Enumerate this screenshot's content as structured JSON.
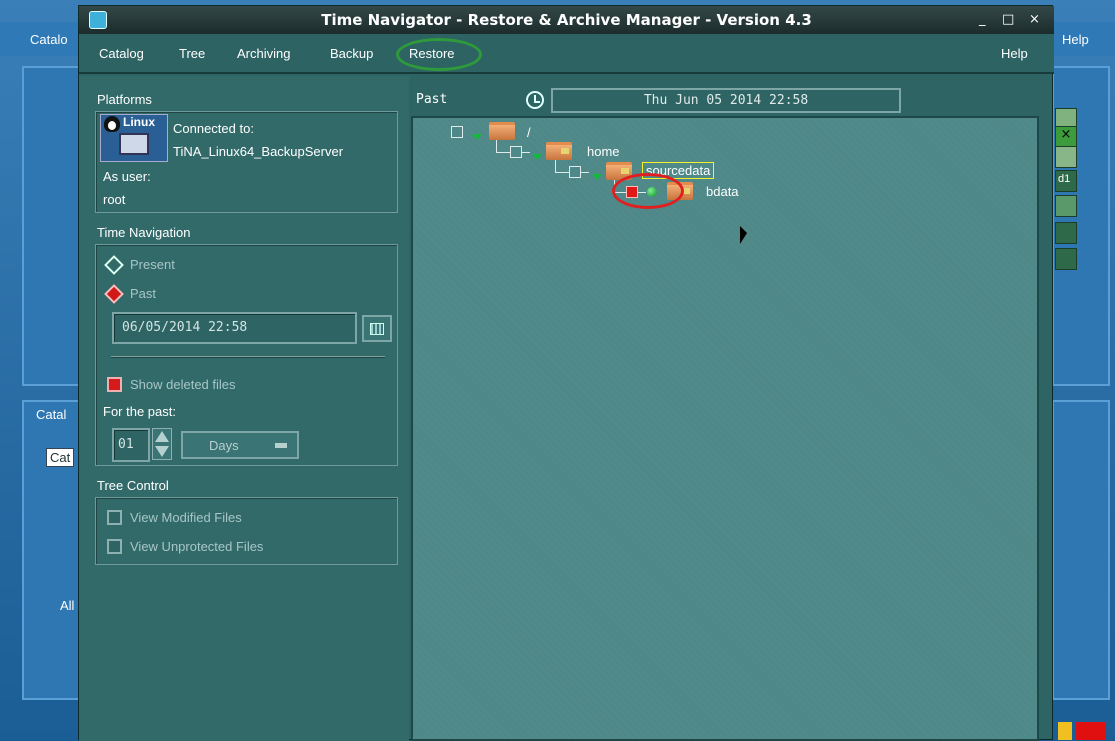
{
  "background_window": {
    "menu_left": "Catalo",
    "menu_right": "Help",
    "panel_tab": "Catal",
    "panel_combo": "Cat",
    "panel_all": "All",
    "right_item": "d1"
  },
  "window": {
    "title": "Time Navigator - Restore & Archive Manager - Version 4.3",
    "controls": {
      "minimize": "_",
      "maximize": "□",
      "close": "×"
    }
  },
  "menu": {
    "items": [
      "Catalog",
      "Tree",
      "Archiving",
      "Backup",
      "Restore"
    ],
    "help": "Help"
  },
  "platforms": {
    "header": "Platforms",
    "logo_text": "Linux",
    "connected_label": "Connected to:",
    "server": "TiNA_Linux64_BackupServer",
    "user_label": "As user:",
    "user": "root"
  },
  "time_navigation": {
    "header": "Time Navigation",
    "present_label": "Present",
    "past_label": "Past",
    "past_value": "06/05/2014 22:58",
    "selected_mode": "Past",
    "show_deleted_label": "Show deleted files",
    "show_deleted_checked": true,
    "for_the_past_label": "For the past:",
    "for_the_past_value": "01",
    "unit": "Days"
  },
  "tree_control": {
    "header": "Tree Control",
    "view_modified": "View Modified Files",
    "view_unprotected": "View Unprotected Files"
  },
  "tree_view": {
    "mode_label": "Past",
    "date_display": "Thu Jun 05 2014 22:58",
    "nodes": [
      {
        "label": "/"
      },
      {
        "label": "home"
      },
      {
        "label": "sourcedata",
        "selected": true
      },
      {
        "label": "bdata",
        "checked": true
      }
    ]
  },
  "colors": {
    "window_bg": "#2f6464",
    "tree_bg": "#4f8888",
    "accent_red": "#d41a1a",
    "highlight_green": "#2e9a3c",
    "desktop_blue": "#2e77b2"
  }
}
